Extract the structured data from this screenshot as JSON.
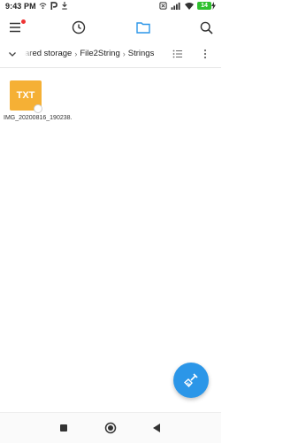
{
  "status_bar": {
    "time": "9:43 PM",
    "battery": "14"
  },
  "toolbar": {
    "menu_icon": "menu-icon",
    "recent_icon": "clock-icon",
    "files_icon": "folder-icon",
    "search_icon": "search-icon",
    "accent": "#2b96e8"
  },
  "breadcrumb": {
    "segments": [
      "ared storage",
      "File2String",
      "Strings"
    ]
  },
  "files": [
    {
      "type_label": "TXT",
      "name": "IMG_20200816_190238.",
      "icon_color": "#f5b035"
    }
  ],
  "fab": {
    "icon": "clean-brush-icon",
    "color": "#2b96e8"
  },
  "nav": {
    "recents": "square-icon",
    "home": "circle-icon",
    "back": "triangle-back-icon"
  }
}
